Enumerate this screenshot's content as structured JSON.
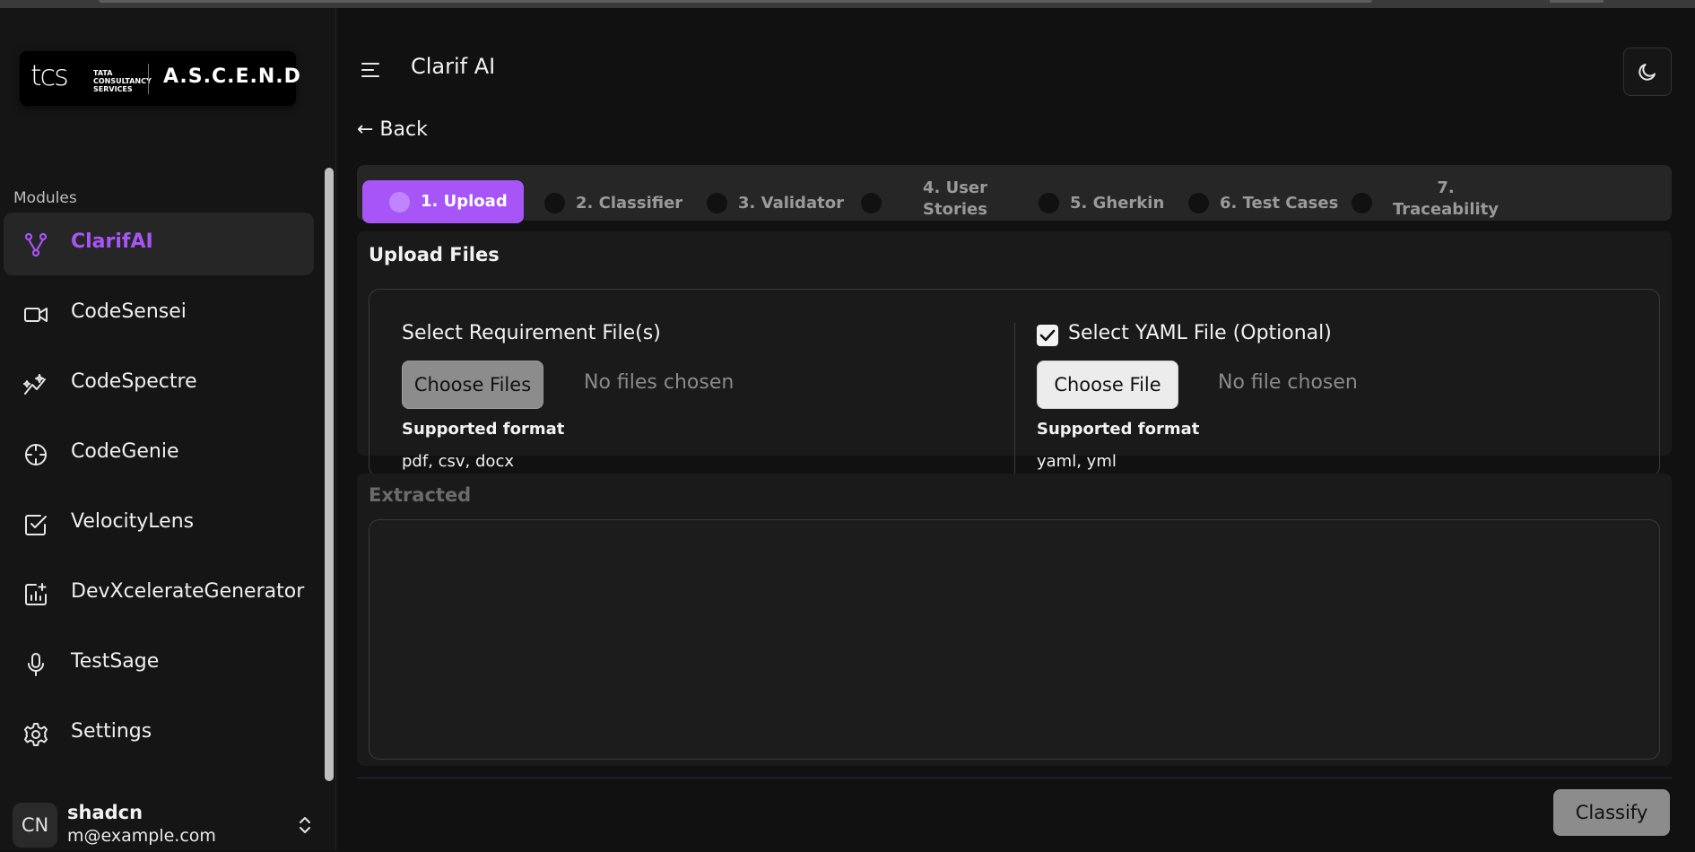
{
  "brand": {
    "tcs": "tcs",
    "tcs_sub": "TATA CONSULTANCY SERVICES",
    "product": "A.S.C.E.N.D"
  },
  "sidebar": {
    "section_label": "Modules",
    "items": [
      {
        "label": "ClarifAI",
        "icon": "git-branch-icon",
        "active": true
      },
      {
        "label": "CodeSensei",
        "icon": "video-camera-icon"
      },
      {
        "label": "CodeSpectre",
        "icon": "sparkle-chart-icon"
      },
      {
        "label": "CodeGenie",
        "icon": "crosshair-icon"
      },
      {
        "label": "VelocityLens",
        "icon": "checkbox-icon"
      },
      {
        "label": "DevXcelerateGenerator",
        "icon": "chart-plus-icon"
      },
      {
        "label": "TestSage",
        "icon": "microphone-icon"
      },
      {
        "label": "Settings",
        "icon": "gear-icon"
      }
    ],
    "user": {
      "initials": "CN",
      "name": "shadcn",
      "email": "m@example.com"
    }
  },
  "header": {
    "title": "Clarif AI",
    "back_label": "← Back"
  },
  "steps": [
    {
      "label": "1. Upload",
      "active": true
    },
    {
      "label": "2. Classifier"
    },
    {
      "label": "3. Validator"
    },
    {
      "label": "4. User Stories"
    },
    {
      "label": "5. Gherkin"
    },
    {
      "label": "6. Test Cases"
    },
    {
      "label": "7. Traceability"
    }
  ],
  "upload": {
    "title": "Upload Files",
    "requirement": {
      "label": "Select Requirement File(s)",
      "button": "Choose Files",
      "status": "No files chosen",
      "format_title": "Supported format",
      "formats": "pdf, csv, docx"
    },
    "yaml": {
      "label": "Select YAML File (Optional)",
      "checked": true,
      "button": "Choose File",
      "status": "No file chosen",
      "format_title": "Supported format",
      "formats": "yaml, yml"
    }
  },
  "extracted": {
    "title": "Extracted",
    "content": ""
  },
  "actions": {
    "classify": "Classify"
  },
  "colors": {
    "accent": "#a855f7",
    "background": "#111111",
    "card": "#1a1a1a"
  }
}
